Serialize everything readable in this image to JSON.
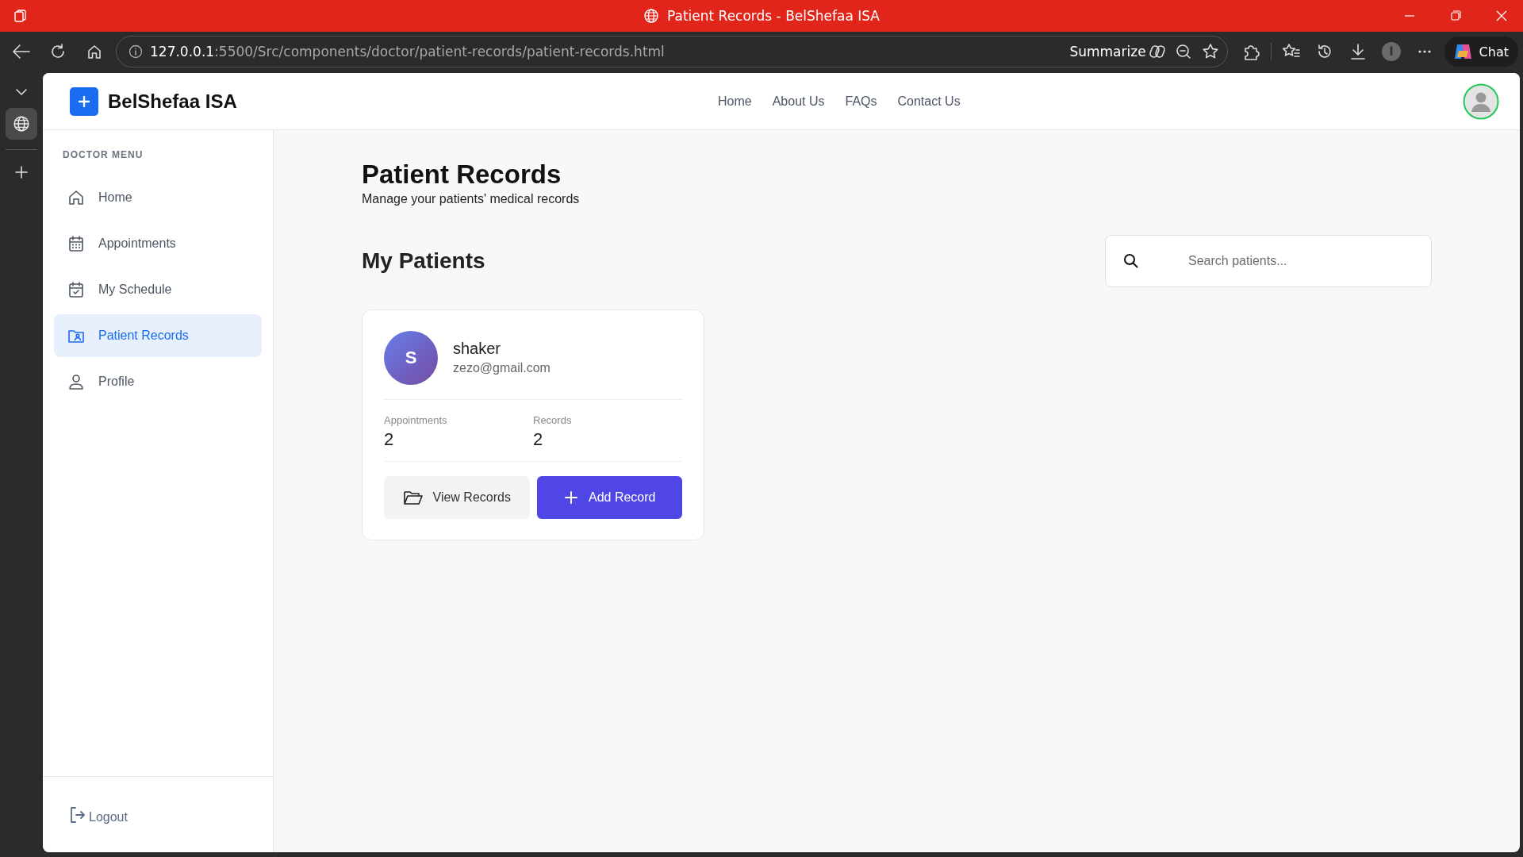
{
  "browser": {
    "title": "Patient Records - BelShefaa ISA",
    "url": {
      "host": "127.0.0.1",
      "path": ":5500/Src/components/doctor/patient-records/patient-records.html"
    },
    "summarize": "Summarize",
    "chat": "Chat",
    "vertical_tabs": [
      {
        "selected": true
      }
    ]
  },
  "header": {
    "brand": "BelShefaa ISA",
    "nav": [
      "Home",
      "About Us",
      "FAQs",
      "Contact Us"
    ]
  },
  "sidebar": {
    "heading": "DOCTOR MENU",
    "items": [
      {
        "label": "Home",
        "selected": false
      },
      {
        "label": "Appointments",
        "selected": false
      },
      {
        "label": "My Schedule",
        "selected": false
      },
      {
        "label": "Patient Records",
        "selected": true
      },
      {
        "label": "Profile",
        "selected": false
      }
    ],
    "logout": "Logout"
  },
  "page": {
    "title": "Patient Records",
    "subtitle": "Manage your patients' medical records",
    "section": "My Patients",
    "search": {
      "placeholder": "Search patients..."
    }
  },
  "patients": [
    {
      "initial": "S",
      "name": "shaker",
      "email": "zezo@gmail.com",
      "stats": [
        {
          "label": "Appointments",
          "value": "2"
        },
        {
          "label": "Records",
          "value": "2"
        }
      ],
      "actions": [
        {
          "label": "View Records",
          "kind": "secondary"
        },
        {
          "label": "Add Record",
          "kind": "primary"
        }
      ]
    }
  ]
}
